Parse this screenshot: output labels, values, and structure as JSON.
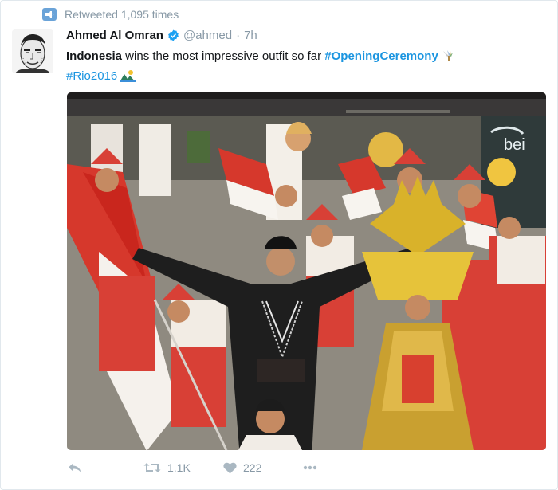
{
  "context": {
    "text": "Retweeted 1,095 times",
    "icon": "retweet-badge-icon"
  },
  "author": {
    "name": "Ahmed Al Omran",
    "handle": "@ahmed",
    "separator": "·",
    "time": "7h",
    "verified": true
  },
  "tweet": {
    "bold_word": "Indonesia",
    "body": " wins the most impressive outfit so far ",
    "hashtag1": "#OpeningCeremony",
    "hashtag2": "#Rio2016"
  },
  "photo": {
    "watermark": "bei",
    "description_icon": "photo-icon"
  },
  "actions": {
    "reply_icon": "reply-icon",
    "retweet_icon": "retweet-icon",
    "retweet_count": "1.1K",
    "like_icon": "heart-icon",
    "like_count": "222",
    "more_icon": "more-icon"
  },
  "colors": {
    "accent": "#1b95e0",
    "muted": "#8899a6",
    "border": "#e1e8ed",
    "retweet_badge": "#6aa3d8"
  }
}
